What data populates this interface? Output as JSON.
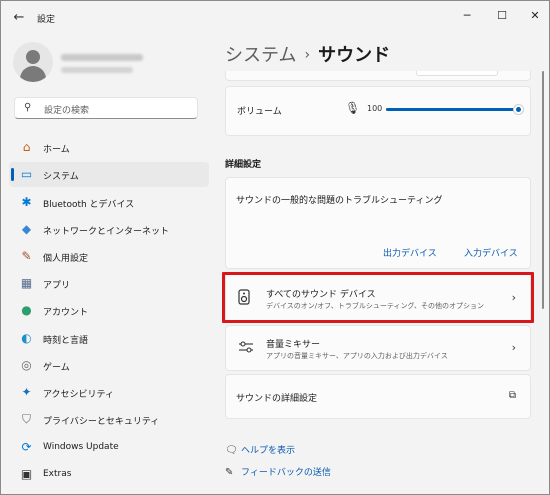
{
  "window": {
    "title": "設定",
    "back_icon": "back-arrow-icon",
    "minimize": "─",
    "maximize": "☐",
    "close": "✕"
  },
  "search": {
    "placeholder": "設定の検索",
    "icon": "search-icon"
  },
  "nav": {
    "items": [
      {
        "label": "ホーム",
        "icon": "home-icon",
        "glyph": "⌂",
        "color": "#c55a11"
      },
      {
        "label": "システム",
        "icon": "system-icon",
        "glyph": "▭",
        "color": "#0078d4",
        "selected": true
      },
      {
        "label": "Bluetooth とデバイス",
        "icon": "bluetooth-icon",
        "glyph": "✱",
        "color": "#0078d4"
      },
      {
        "label": "ネットワークとインターネット",
        "icon": "network-icon",
        "glyph": "◆",
        "color": "#3a86d6"
      },
      {
        "label": "個人用設定",
        "icon": "personalization-icon",
        "glyph": "✎",
        "color": "#a0522d"
      },
      {
        "label": "アプリ",
        "icon": "apps-icon",
        "glyph": "▦",
        "color": "#556b8a"
      },
      {
        "label": "アカウント",
        "icon": "account-icon",
        "glyph": "●",
        "color": "#2e9e6e"
      },
      {
        "label": "時刻と言語",
        "icon": "time-language-icon",
        "glyph": "◐",
        "color": "#1e90c9"
      },
      {
        "label": "ゲーム",
        "icon": "gaming-icon",
        "glyph": "◎",
        "color": "#666666"
      },
      {
        "label": "アクセシビリティ",
        "icon": "accessibility-icon",
        "glyph": "✦",
        "color": "#1b6fc2"
      },
      {
        "label": "プライバシーとセキュリティ",
        "icon": "shield-icon",
        "glyph": "⛉",
        "color": "#6b6b6b"
      },
      {
        "label": "Windows Update",
        "icon": "windows-update-icon",
        "glyph": "⟳",
        "color": "#0078d4"
      },
      {
        "label": "Extras",
        "icon": "extras-icon",
        "glyph": "▣",
        "color": "#333333"
      }
    ]
  },
  "header": {
    "parent": "システム",
    "separator": "›",
    "current": "サウンド"
  },
  "volume": {
    "label": "ボリューム",
    "value": "100",
    "level": 1.0,
    "icon": "microphone-icon"
  },
  "advanced": {
    "section_title": "詳細設定",
    "troubleshoot": {
      "title": "サウンドの一般的な問題のトラブルシューティング",
      "output_label": "出力デバイス",
      "input_label": "入力デバイス"
    },
    "all_devices": {
      "title": "すべてのサウンド デバイス",
      "subtitle": "デバイスのオン/オフ、トラブルシューティング、その他のオプション",
      "icon": "speaker-device-icon"
    },
    "mixer": {
      "title": "音量ミキサー",
      "subtitle": "アプリの音量ミキサー、アプリの入力および出力デバイス",
      "icon": "mixer-icon"
    },
    "more_settings": {
      "title": "サウンドの詳細設定",
      "icon": "open-external-icon"
    }
  },
  "footer": {
    "help": "ヘルプを表示",
    "feedback": "フィードバックの送信"
  },
  "colors": {
    "accent": "#005fb8",
    "highlight_border": "#d8171b"
  }
}
